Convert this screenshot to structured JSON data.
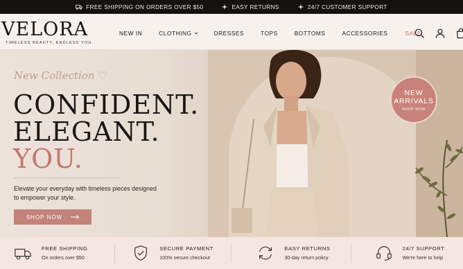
{
  "announcement": {
    "items": [
      {
        "icon": "truck-icon",
        "text": "FREE SHIPPING ON ORDERS OVER $50"
      },
      {
        "icon": "sparkle-icon",
        "text": "EASY RETURNS"
      },
      {
        "icon": "sparkle-icon",
        "text": "24/7 CUSTOMER SUPPORT"
      }
    ]
  },
  "header": {
    "logo": "VELORA",
    "tagline": "TIMELESS BEAUTY, ENDLESS YOU.",
    "nav": [
      "NEW IN",
      "CLOTHING",
      "DRESSES",
      "TOPS",
      "BOTTOMS",
      "ACCESSORIES",
      "SALE"
    ],
    "icons": [
      "search-icon",
      "user-icon",
      "bag-icon"
    ]
  },
  "hero": {
    "script_text": "New Collection ♡",
    "headline": [
      "CONFIDENT.",
      "ELEGANT.",
      "YOU."
    ],
    "description": "Elevate your everyday with timeless pieces designed to empower your style.",
    "cta": "SHOP NOW",
    "badge": {
      "line1": "NEW",
      "line2": "ARRIVALS",
      "line3": "SHOP NOW"
    }
  },
  "features": [
    {
      "icon": "truck-icon",
      "title": "FREE SHIPPING",
      "subtitle": "On orders over $50"
    },
    {
      "icon": "shield-check-icon",
      "title": "SECURE PAYMENT",
      "subtitle": "100% secure checkout"
    },
    {
      "icon": "return-arrows-icon",
      "title": "EASY RETURNS",
      "subtitle": "30-day return policy"
    },
    {
      "icon": "headset-icon",
      "title": "24/7 SUPPORT",
      "subtitle": "We're here to help"
    }
  ],
  "colors": {
    "accent": "#c48279",
    "dark": "#141211",
    "background": "#f6ece6"
  }
}
